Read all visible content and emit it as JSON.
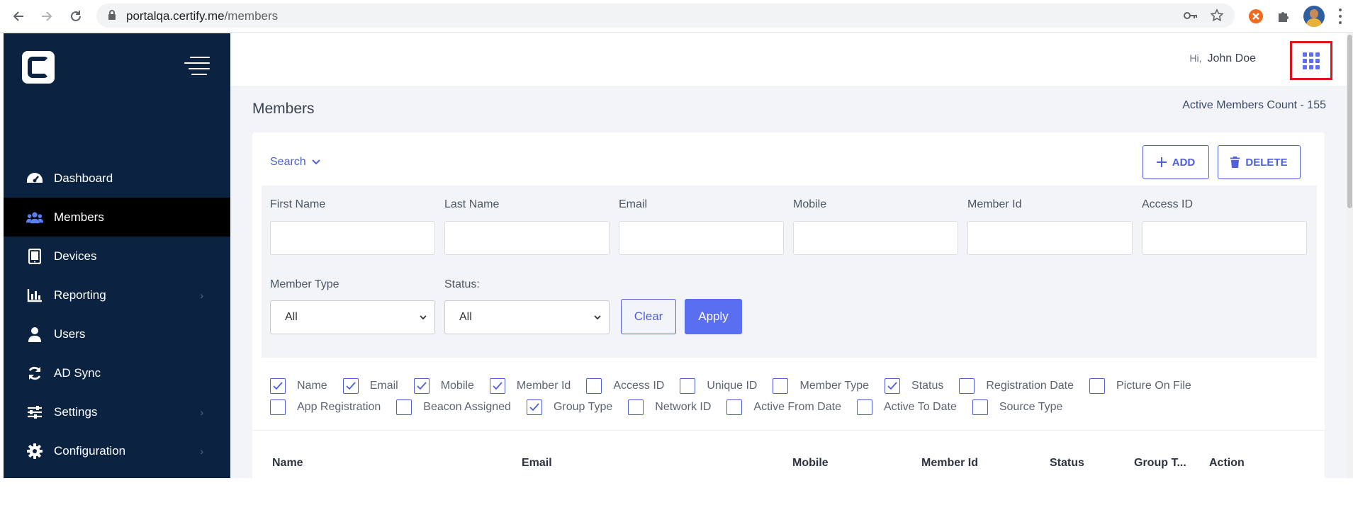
{
  "browser": {
    "url_host": "portalqa.certify.me",
    "url_path": "/members"
  },
  "sidebar": {
    "items": [
      {
        "label": "Dashboard",
        "icon": "dashboard-icon",
        "active": false,
        "chevron": false
      },
      {
        "label": "Members",
        "icon": "members-icon",
        "active": true,
        "chevron": false
      },
      {
        "label": "Devices",
        "icon": "tablet-icon",
        "active": false,
        "chevron": false
      },
      {
        "label": "Reporting",
        "icon": "chart-icon",
        "active": false,
        "chevron": true
      },
      {
        "label": "Users",
        "icon": "user-icon",
        "active": false,
        "chevron": false
      },
      {
        "label": "AD Sync",
        "icon": "sync-icon",
        "active": false,
        "chevron": false
      },
      {
        "label": "Settings",
        "icon": "sliders-icon",
        "active": false,
        "chevron": true
      },
      {
        "label": "Configuration",
        "icon": "gear-icon",
        "active": false,
        "chevron": true
      }
    ]
  },
  "header": {
    "greeting": "Hi,",
    "user_name": "John Doe"
  },
  "main": {
    "title": "Members",
    "active_count": "Active Members Count - 155",
    "search_toggle": "Search",
    "add_label": "ADD",
    "delete_label": "DELETE"
  },
  "filters": {
    "first_name": "First Name",
    "last_name": "Last Name",
    "email": "Email",
    "mobile": "Mobile",
    "member_id": "Member Id",
    "access_id": "Access ID",
    "member_type_label": "Member Type",
    "member_type_value": "All",
    "status_label": "Status:",
    "status_value": "All",
    "clear": "Clear",
    "apply": "Apply"
  },
  "columns": {
    "row1": [
      {
        "label": "Name",
        "checked": true
      },
      {
        "label": "Email",
        "checked": true
      },
      {
        "label": "Mobile",
        "checked": true
      },
      {
        "label": "Member Id",
        "checked": true
      },
      {
        "label": "Access ID",
        "checked": false
      },
      {
        "label": "Unique ID",
        "checked": false
      },
      {
        "label": "Member Type",
        "checked": false
      },
      {
        "label": "Status",
        "checked": true
      },
      {
        "label": "Registration Date",
        "checked": false
      },
      {
        "label": "Picture On File",
        "checked": false
      }
    ],
    "row2": [
      {
        "label": "App Registration",
        "checked": false
      },
      {
        "label": "Beacon Assigned",
        "checked": false
      },
      {
        "label": "Group Type",
        "checked": true
      },
      {
        "label": "Network ID",
        "checked": false
      },
      {
        "label": "Active From Date",
        "checked": false
      },
      {
        "label": "Active To Date",
        "checked": false
      },
      {
        "label": "Source Type",
        "checked": false
      }
    ]
  },
  "table": {
    "headers": [
      "Name",
      "Email",
      "Mobile",
      "Member Id",
      "Status",
      "Group T...",
      "Action"
    ]
  },
  "colors": {
    "sidebar_bg": "#0b2341",
    "accent": "#5a6ef2",
    "highlight_box": "#e1141b"
  }
}
